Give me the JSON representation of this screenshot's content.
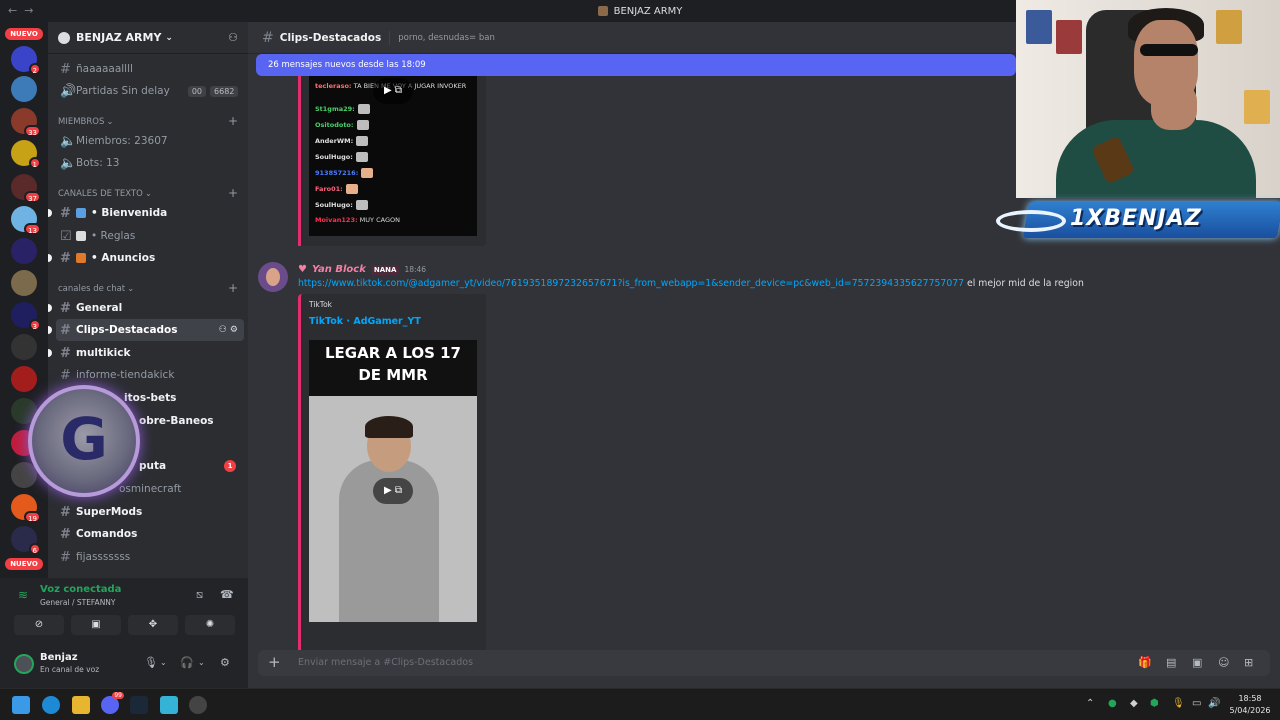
{
  "window": {
    "title": "BENJAZ ARMY",
    "nav_back": "←",
    "nav_fwd": "→"
  },
  "rail": {
    "new_top": "NUEVO",
    "new_bottom": "NUEVO",
    "badges": [
      "2",
      "33",
      "1",
      "37",
      "13",
      "3",
      "13",
      "19",
      "6"
    ]
  },
  "server": {
    "name": "BENJAZ ARMY",
    "chevron": "⌄"
  },
  "channels_top": [
    {
      "label": "ñaaaaaallll"
    },
    {
      "label": "Partidas Sin delay",
      "chip1": "00",
      "chip2": "6682"
    },
    {
      "label": "MIEMBROS"
    },
    {
      "label": "Miembros: 23607"
    },
    {
      "label": "Bots: 13"
    }
  ],
  "categories": {
    "miembros": "MIEMBROS",
    "texto": "CANALES DE TEXTO",
    "chat": "canales de chat"
  },
  "channels": {
    "partidas": "Partidas Sin delay",
    "partidas_chip1": "00",
    "partidas_chip2": "6682",
    "n": "ñaaaaaallll",
    "miembros": "Miembros: 23607",
    "bots": "Bots: 13",
    "bienvenida": "• Bienvenida",
    "reglas": "• Reglas",
    "anuncios": "• Anuncios",
    "general": "General",
    "clips": "Clips-Destacados",
    "multikick": "multikick",
    "informe": "informe-tiendakick",
    "bets": "itos-bets",
    "baneos": "obre-Baneos",
    "puta": "puta",
    "puta_badge": "1",
    "minecraft": "osminecraft",
    "supermods": "SuperMods",
    "comandos": "Comandos",
    "fijas": "fijasssssss"
  },
  "voice": {
    "status": "Voz conectada",
    "channel": "General / STEFANNY"
  },
  "user": {
    "name": "Benjaz",
    "status": "En canal de voz"
  },
  "chat": {
    "channel": "Clips-Destacados",
    "topic": "porno, desnudas= ban",
    "new_messages": "26 mensajes nuevos desde las 18:09",
    "stream_chat": [
      {
        "name": "tecleraso:",
        "text": "TA BIEN ME VOY A JUGAR INVOKER",
        "color": "#ff7070"
      },
      {
        "name": "St1gma29:",
        "text": "",
        "color": "#4ccf6c"
      },
      {
        "name": "Ositodoto:",
        "text": "",
        "color": "#4ccf6c"
      },
      {
        "name": "AnderWM:",
        "text": "",
        "color": "#e0e0e0"
      },
      {
        "name": "SoulHugo:",
        "text": "",
        "color": "#e0e0e0"
      },
      {
        "name": "913857216:",
        "text": "",
        "color": "#4c7cff"
      },
      {
        "name": "Faro01:",
        "text": "",
        "color": "#ff6080"
      },
      {
        "name": "SoulHugo:",
        "text": "",
        "color": "#e0e0e0"
      },
      {
        "name": "Moivan123:",
        "text": "MUY CAGON",
        "color": "#ff3050"
      }
    ],
    "message": {
      "author": "Yan Block",
      "tag": "NANA",
      "time": "18:46",
      "link": "https://www.tiktok.com/@adgamer_yt/video/7619351897232657671?is_from_webapp=1&sender_device=pc&web_id=7572394335627757077",
      "text": " el mejor mid de la region",
      "embed_provider": "TikTok",
      "embed_title": "TikTok · AdGamer_YT",
      "video_caption_1": "LEGAR A LOS 17",
      "video_caption_2": "DE MMR"
    },
    "composer_placeholder": "Enviar mensaje a #Clips-Destacados"
  },
  "overlay": {
    "logo_text": "1XBENJAZ",
    "g_letter": "G"
  },
  "taskbar": {
    "time": "18:58",
    "date": "5/04/2026",
    "discord_badge": "99"
  },
  "colors": {
    "accent": "#5865f2",
    "brand_pink": "#e52d6d",
    "online": "#23a55a",
    "danger": "#f23f43"
  }
}
